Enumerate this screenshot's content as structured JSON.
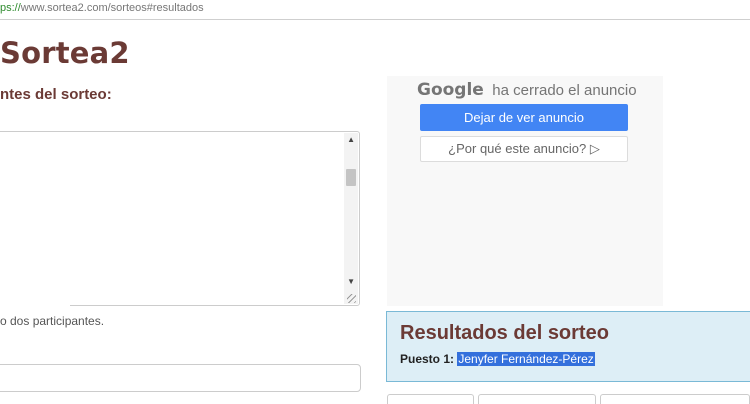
{
  "browser": {
    "url_scheme": "ps://",
    "url_rest": "www.sortea2.com/sorteos#resultados"
  },
  "site": {
    "title": "Sortea2"
  },
  "form": {
    "participants_label": "ntes del sorteo:",
    "participants_value": "",
    "help_text": "o dos participantes.",
    "extra_input_value": ""
  },
  "ad": {
    "brand": "Google",
    "closed_text": "ha cerrado el anuncio",
    "stop_button": "Dejar de ver anuncio",
    "why_button": "¿Por qué este anuncio? ▷"
  },
  "results": {
    "title": "Resultados del sorteo",
    "position_label": "Puesto 1:",
    "winner": "Jenyfer Fernández-Pérez"
  },
  "colors": {
    "brand": "#6b3a35",
    "ad_button": "#4285f4",
    "results_bg": "#ddeef6",
    "selection": "#3470dc"
  }
}
